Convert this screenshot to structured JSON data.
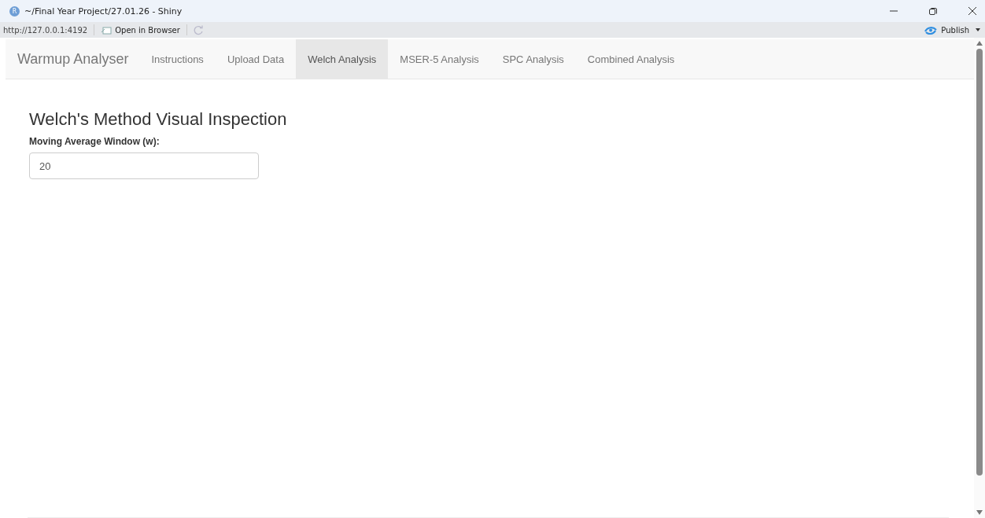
{
  "window": {
    "app_logo": "R",
    "title": "~/Final Year Project/27.01.26 - Shiny"
  },
  "toolbar": {
    "url": "http://127.0.0.1:4192",
    "open_in_browser": "Open in Browser",
    "publish": "Publish"
  },
  "navbar": {
    "brand": "Warmup Analyser",
    "tabs": [
      {
        "label": "Instructions",
        "selected": false
      },
      {
        "label": "Upload Data",
        "selected": false
      },
      {
        "label": "Welch Analysis",
        "selected": true
      },
      {
        "label": "MSER-5 Analysis",
        "selected": false
      },
      {
        "label": "SPC Analysis",
        "selected": false
      },
      {
        "label": "Combined Analysis",
        "selected": false
      }
    ]
  },
  "content": {
    "heading": "Welch's Method Visual Inspection",
    "field": {
      "label": "Moving Average Window (w):",
      "value": "20"
    }
  }
}
